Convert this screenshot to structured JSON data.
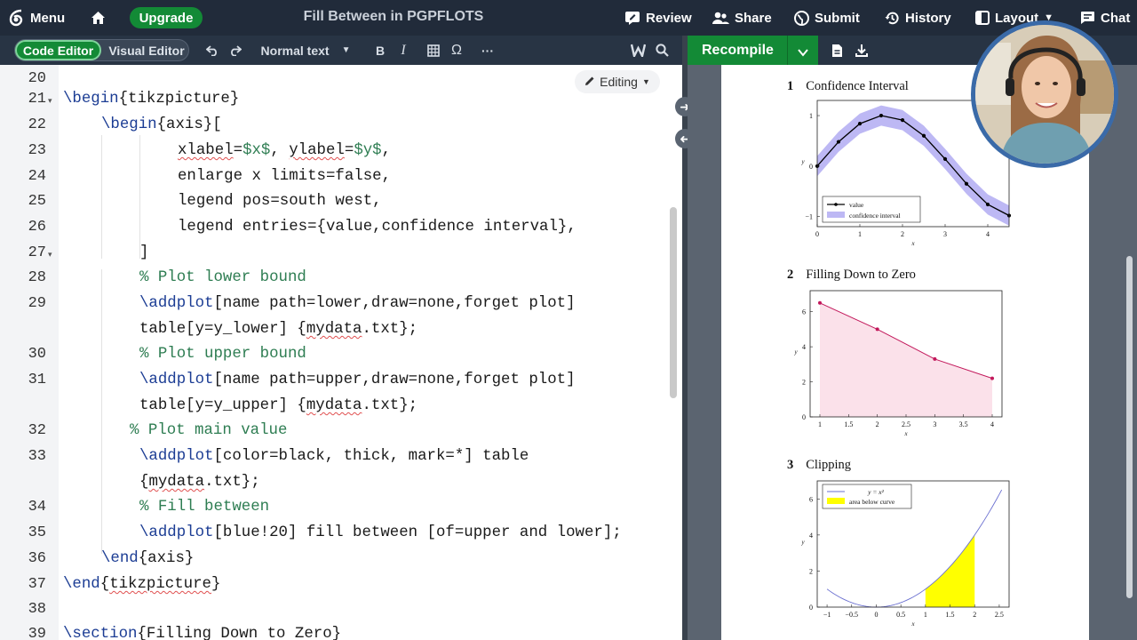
{
  "topbar": {
    "menu_label": "Menu",
    "upgrade_label": "Upgrade",
    "project_title": "Fill Between in PGPFLOTS",
    "review_label": "Review",
    "share_label": "Share",
    "submit_label": "Submit",
    "history_label": "History",
    "layout_label": "Layout",
    "chat_label": "Chat"
  },
  "toolbar": {
    "code_editor_label": "Code Editor",
    "visual_editor_label": "Visual Editor",
    "text_style": "Normal text",
    "bold_label": "B",
    "italic_label": "I",
    "omega_label": "Ω",
    "more_label": "···"
  },
  "editor": {
    "editing_label": "Editing",
    "line_numbers": [
      "20",
      "21",
      "22",
      "23",
      "24",
      "25",
      "26",
      "27",
      "28",
      "29",
      "30",
      "31",
      "32",
      "33",
      "34",
      "35",
      "36",
      "37",
      "38",
      "39"
    ]
  },
  "pdf": {
    "recompile_label": "Recompile",
    "sections": [
      {
        "num": "1",
        "title": "Confidence Interval"
      },
      {
        "num": "2",
        "title": "Filling Down to Zero"
      },
      {
        "num": "3",
        "title": "Clipping"
      }
    ]
  },
  "colors": {
    "brand_green": "#138a36",
    "topbar_bg": "#212b3a",
    "band": "#bdb8f4",
    "pink_fill": "#fbe1ea",
    "magenta": "#c2185b",
    "yellow": "#ffff00"
  },
  "chart_data": [
    {
      "type": "line",
      "xlabel": "x",
      "ylabel": "y",
      "xlim": [
        0,
        4.5
      ],
      "ylim": [
        -1.2,
        1.3
      ],
      "xticks": [
        "0",
        "1",
        "2",
        "3",
        "4"
      ],
      "yticks": [
        "−1",
        "0",
        "1"
      ],
      "legend_position": "bottom-left",
      "series": [
        {
          "name": "value",
          "x": [
            0,
            0.5,
            1,
            1.5,
            2,
            2.5,
            3,
            3.5,
            4,
            4.5
          ],
          "y": [
            0,
            0.48,
            0.84,
            1.0,
            0.91,
            0.6,
            0.14,
            -0.35,
            -0.76,
            -0.98
          ]
        },
        {
          "name": "confidence interval",
          "x": [
            0,
            0.5,
            1,
            1.5,
            2,
            2.5,
            3,
            3.5,
            4,
            4.5
          ],
          "lower": [
            -0.2,
            0.28,
            0.64,
            0.8,
            0.71,
            0.4,
            -0.06,
            -0.55,
            -0.96,
            -1.18
          ],
          "upper": [
            0.2,
            0.68,
            1.04,
            1.2,
            1.11,
            0.8,
            0.34,
            -0.15,
            -0.56,
            -0.78
          ]
        }
      ]
    },
    {
      "type": "area",
      "xlabel": "x",
      "ylabel": "y",
      "xlim": [
        0.83,
        4.17
      ],
      "ylim": [
        0,
        7.2
      ],
      "xticks": [
        "1",
        "1.5",
        "2",
        "2.5",
        "3",
        "3.5",
        "4"
      ],
      "yticks": [
        "0",
        "2",
        "4",
        "6"
      ],
      "series": [
        {
          "x": [
            1,
            2,
            3,
            4
          ],
          "y": [
            6.5,
            5.0,
            3.3,
            2.2
          ]
        }
      ]
    },
    {
      "type": "area",
      "xlabel": "x",
      "ylabel": "y",
      "xlim": [
        -1.2,
        2.7
      ],
      "ylim": [
        0,
        7
      ],
      "xticks": [
        "−1",
        "−0.5",
        "0",
        "0.5",
        "1",
        "1.5",
        "2",
        "2.5"
      ],
      "yticks": [
        "0",
        "2",
        "4",
        "6"
      ],
      "legend_position": "top-left",
      "series": [
        {
          "name": "y = x²",
          "function": "x^2"
        },
        {
          "name": "area below curve",
          "fill_range": [
            1,
            2
          ]
        }
      ]
    }
  ]
}
